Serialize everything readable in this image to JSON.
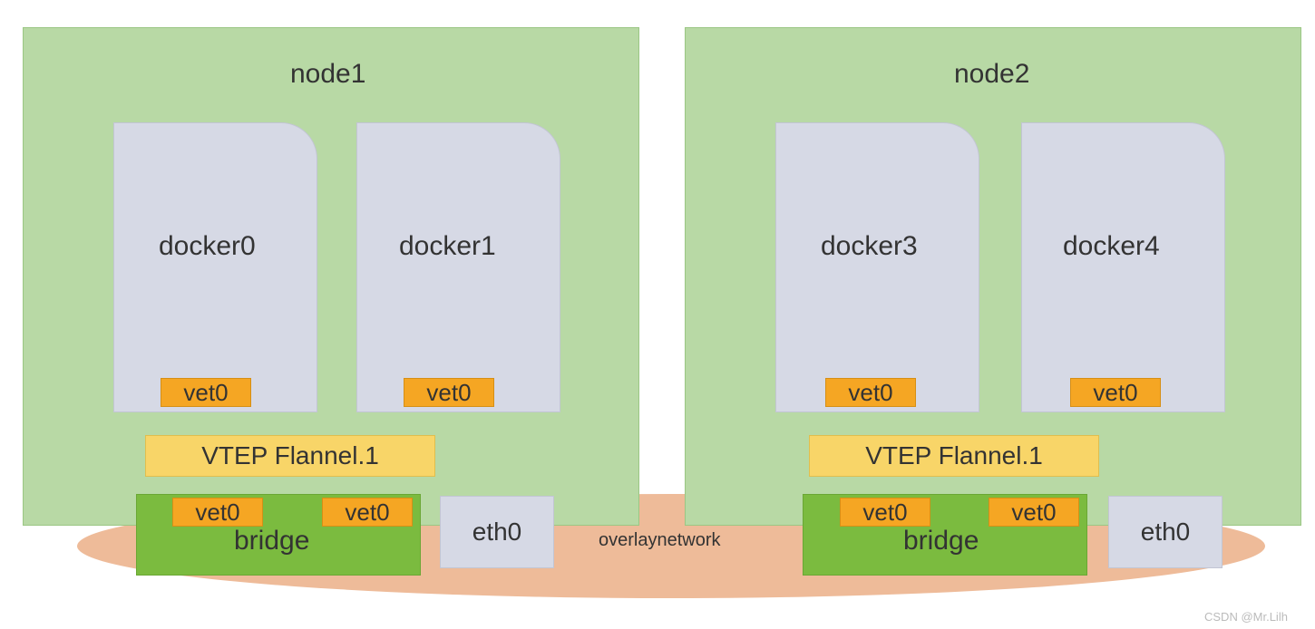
{
  "nodes": [
    {
      "title": "node1",
      "dockers": [
        {
          "label": "docker0",
          "vet": "vet0"
        },
        {
          "label": "docker1",
          "vet": "vet0"
        }
      ],
      "vtep": "VTEP Flannel.1",
      "bridge": {
        "label": "bridge",
        "vets": [
          "vet0",
          "vet0"
        ]
      },
      "eth": "eth0"
    },
    {
      "title": "node2",
      "dockers": [
        {
          "label": "docker3",
          "vet": "vet0"
        },
        {
          "label": "docker4",
          "vet": "vet0"
        }
      ],
      "vtep": "VTEP Flannel.1",
      "bridge": {
        "label": "bridge",
        "vets": [
          "vet0",
          "vet0"
        ]
      },
      "eth": "eth0"
    }
  ],
  "overlay_label": "overlaynetwork",
  "watermark": "CSDN @Mr.Lilh"
}
